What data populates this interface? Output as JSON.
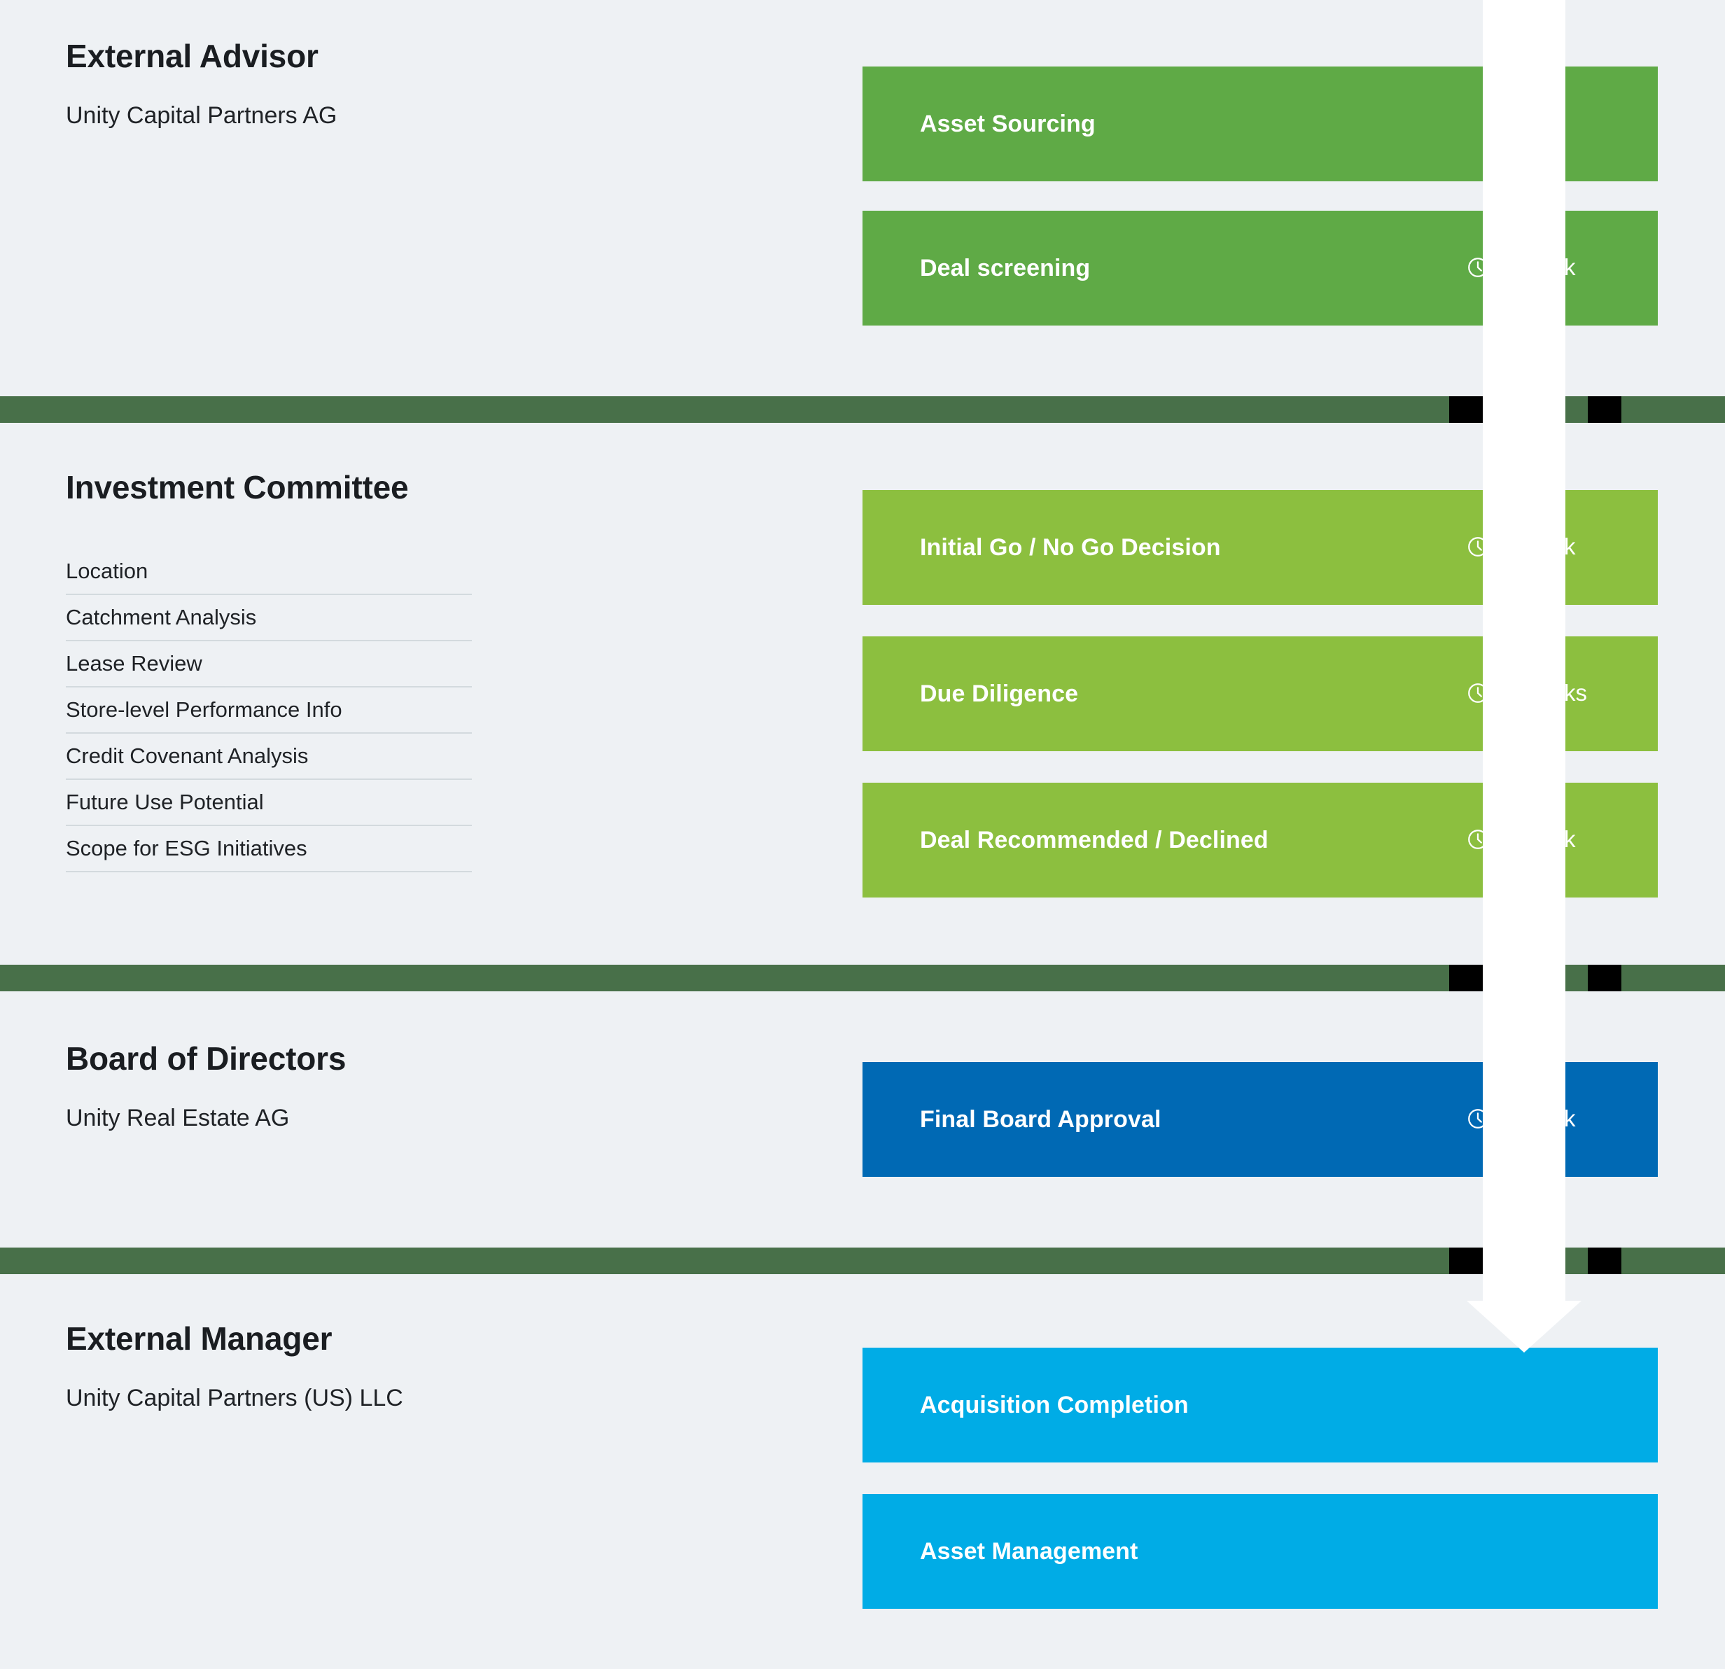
{
  "meta": {
    "background_color": "#eef1f4",
    "divider_color": "#487049",
    "arrow_color": "#ffffff"
  },
  "lanes": [
    {
      "id": "external-advisor",
      "title": "External Advisor",
      "subtitle": "Unity Capital Partners AG",
      "bar_color": "#5faa46",
      "tasks": [
        {
          "label": "Asset Sourcing",
          "duration": ""
        },
        {
          "label": "Deal screening",
          "duration": "1 week"
        }
      ]
    },
    {
      "id": "investment-committee",
      "title": "Investment Committee",
      "subtitle": "",
      "bar_color": "#8cbf3f",
      "criteria": [
        "Location",
        "Catchment Analysis",
        "Lease Review",
        "Store-level Performance Info",
        "Credit Covenant Analysis",
        "Future Use Potential",
        "Scope for ESG Initiatives"
      ],
      "tasks": [
        {
          "label": "Initial Go / No Go Decision",
          "duration": "1 week"
        },
        {
          "label": "Due Diligence",
          "duration": "3 weeks"
        },
        {
          "label": "Deal Recommended / Declined",
          "duration": "1 week"
        }
      ]
    },
    {
      "id": "board-of-directors",
      "title": "Board of Directors",
      "subtitle": "Unity Real Estate AG",
      "bar_color": "#0069b4",
      "tasks": [
        {
          "label": "Final Board Approval",
          "duration": "1 week"
        }
      ]
    },
    {
      "id": "external-manager",
      "title": "External Manager",
      "subtitle": "Unity Capital Partners (US) LLC",
      "bar_color": "#00ace6",
      "tasks": [
        {
          "label": "Acquisition Completion",
          "duration": ""
        },
        {
          "label": "Asset Management",
          "duration": ""
        }
      ]
    }
  ],
  "icons": {
    "clock": "clock-icon"
  }
}
